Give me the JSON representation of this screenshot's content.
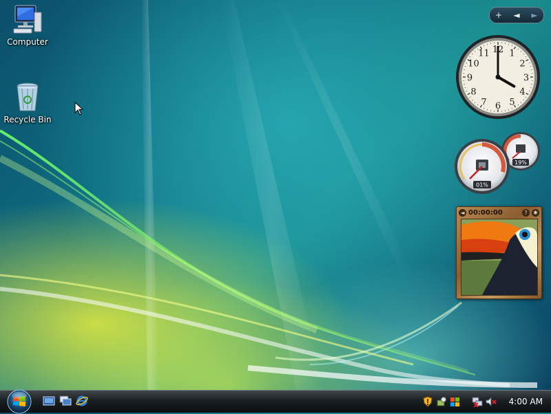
{
  "desktop": {
    "icons": [
      {
        "label": "Computer"
      },
      {
        "label": "Recycle Bin"
      }
    ]
  },
  "sidebar": {
    "controls": [
      "+",
      "◄",
      "►"
    ]
  },
  "gadgets": {
    "clock": {
      "numbers": [
        "12",
        "1",
        "2",
        "3",
        "4",
        "5",
        "6",
        "7",
        "8",
        "9",
        "10",
        "11"
      ],
      "time_hour": 4,
      "time_minute": 0
    },
    "cpu_meter": {
      "cpu_percent": "01%",
      "memory_percent": "19%"
    },
    "slideshow": {
      "elapsed": "00:00:00"
    }
  },
  "taskbar": {
    "quick_launch": [
      "show-desktop-icon",
      "switch-windows-icon",
      "internet-explorer-icon"
    ],
    "tray_icons": [
      "security-shield-icon",
      "windows-defender-icon",
      "windows-update-icon",
      "network-disconnected-icon",
      "volume-muted-icon"
    ],
    "clock": "4:00 AM"
  },
  "colors": {
    "accent": "#1a8d8e",
    "taskbar": "#1b2023"
  }
}
